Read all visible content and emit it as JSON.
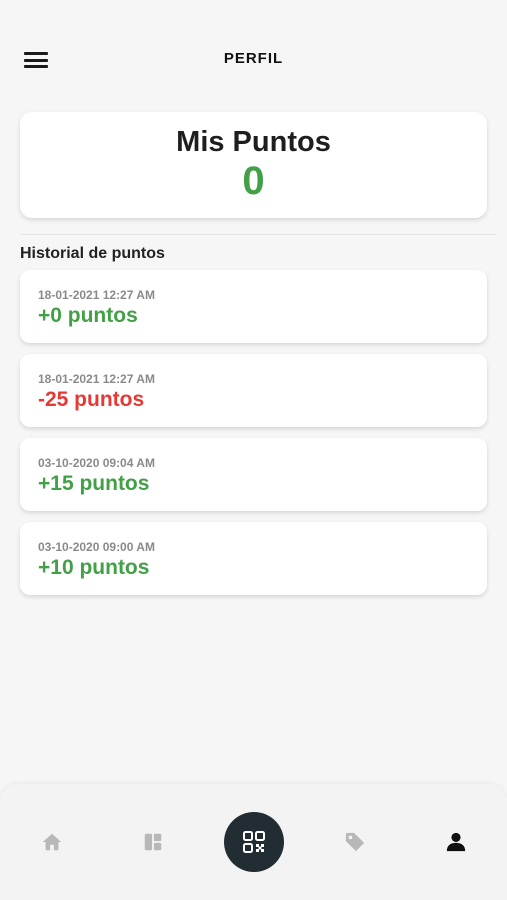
{
  "header": {
    "title": "PERFIL",
    "menu_icon": "hamburger-menu-icon"
  },
  "points": {
    "label": "Mis Puntos",
    "value": "0",
    "color": "#43a047"
  },
  "history": {
    "title": "Historial de puntos",
    "items": [
      {
        "date": "18-01-2021 12:27 AM",
        "amount": "+0 puntos",
        "type": "positive"
      },
      {
        "date": "18-01-2021 12:27 AM",
        "amount": "-25 puntos",
        "type": "negative"
      },
      {
        "date": "03-10-2020 09:04 AM",
        "amount": "+15 puntos",
        "type": "positive"
      },
      {
        "date": "03-10-2020 09:00 AM",
        "amount": "+10 puntos",
        "type": "positive"
      }
    ]
  },
  "colors": {
    "positive": "#43a047",
    "negative": "#e53935",
    "active_nav": "#111111",
    "inactive_nav": "#b8b8b8",
    "qr_bg": "#222c33"
  },
  "nav": [
    {
      "icon": "home-icon",
      "active": false
    },
    {
      "icon": "dashboard-icon",
      "active": false
    },
    {
      "icon": "qr-code-icon",
      "active": false
    },
    {
      "icon": "tag-icon",
      "active": false
    },
    {
      "icon": "profile-icon",
      "active": true
    }
  ]
}
